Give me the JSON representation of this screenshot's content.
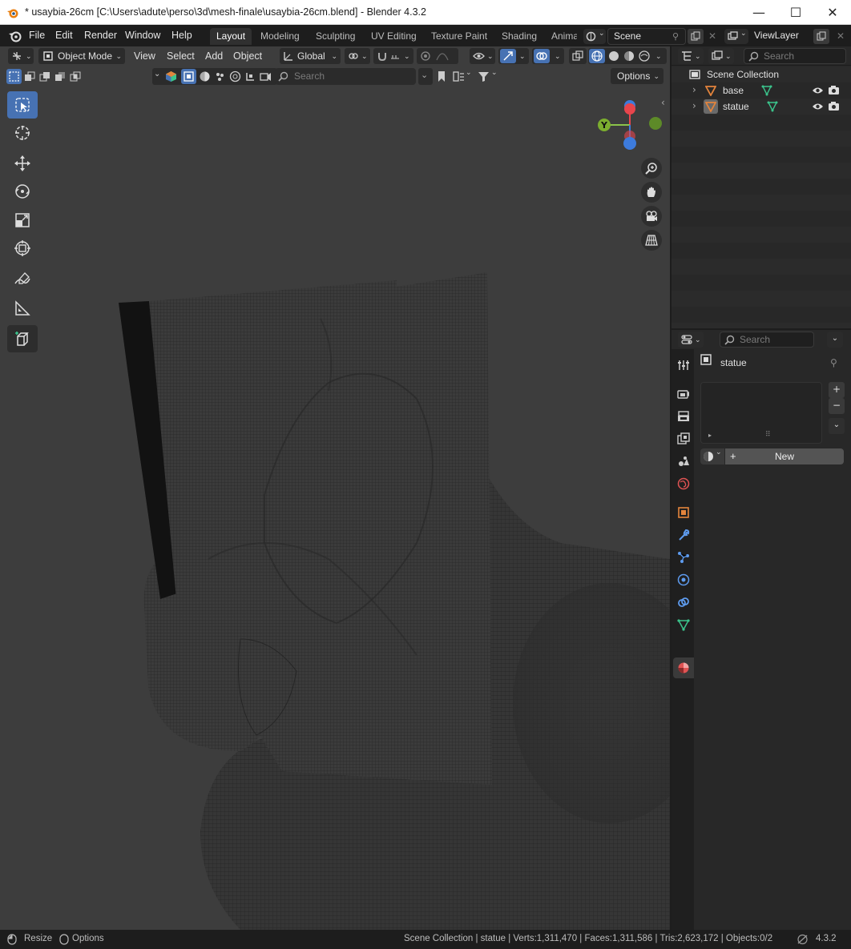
{
  "window": {
    "title": "* usaybia-26cm [C:\\Users\\adute\\perso\\3d\\mesh-finale\\usaybia-26cm.blend] - Blender 4.3.2",
    "minimize": "—",
    "maximize": "☐",
    "close": "✕"
  },
  "menu": {
    "items": [
      "File",
      "Edit",
      "Render",
      "Window",
      "Help"
    ],
    "workspaces": [
      "Layout",
      "Modeling",
      "Sculpting",
      "UV Editing",
      "Texture Paint",
      "Shading",
      "Anima"
    ],
    "active_workspace": "Layout",
    "scene": "Scene",
    "view_layer": "ViewLayer"
  },
  "viewport_header": {
    "mode": "Object Mode",
    "menus": [
      "View",
      "Select",
      "Add",
      "Object"
    ],
    "transform_orientation": "Global",
    "search_placeholder": "Search",
    "options_label": "Options"
  },
  "outliner": {
    "search_placeholder": "Search",
    "root": "Scene Collection",
    "objects": [
      {
        "name": "base"
      },
      {
        "name": "statue"
      }
    ]
  },
  "properties": {
    "search_placeholder": "Search",
    "object_name": "statue",
    "new_button": "New",
    "tabs": [
      "tool-icon",
      "render-icon",
      "output-icon",
      "view-layer-icon",
      "scene-icon",
      "world-icon",
      "object-icon",
      "modifier-icon",
      "particles-icon",
      "physics-icon",
      "constraints-icon",
      "data-icon",
      "material-icon"
    ]
  },
  "gizmo": {
    "y_label": "Y"
  },
  "statusbar": {
    "left_1": "Resize",
    "left_2": "Options",
    "stats": "Scene Collection | statue | Verts:1,311,470 | Faces:1,311,586 | Tris:2,623,172 | Objects:0/2",
    "version": "4.3.2"
  },
  "colors": {
    "accent": "#4772b3",
    "viewport_bg": "#3d3d3d",
    "panel_bg": "#282828",
    "object_orange": "#e3843c",
    "mesh_green": "#3bc48c"
  }
}
